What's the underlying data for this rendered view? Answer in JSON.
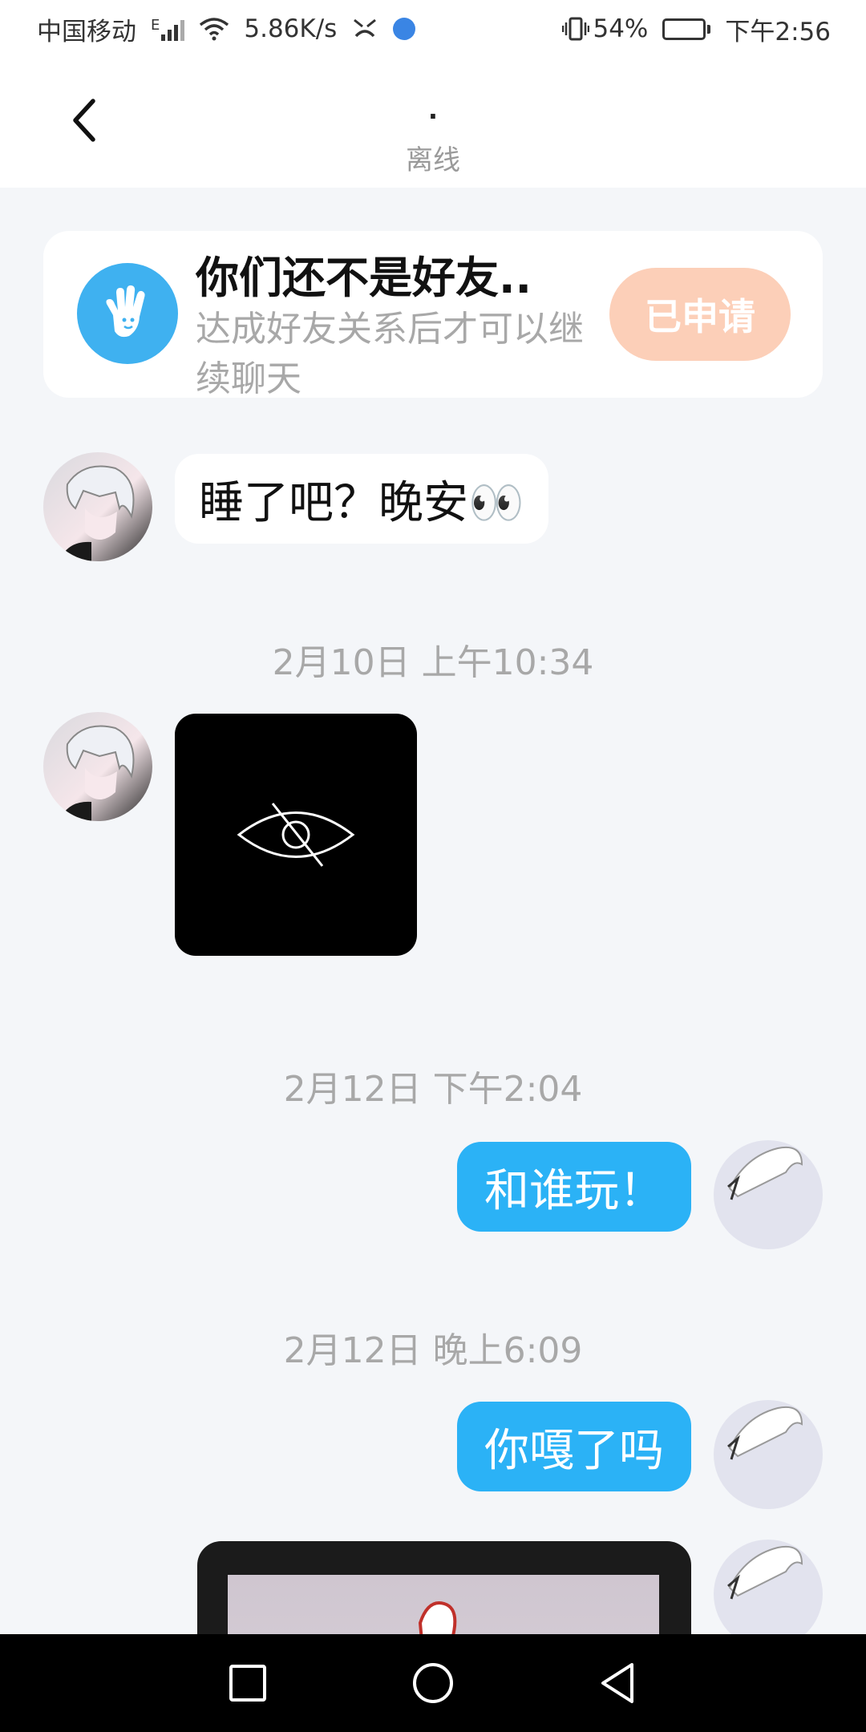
{
  "status_bar": {
    "carrier": "中国移动",
    "network_type": "E",
    "net_speed": "5.86K/s",
    "battery_percent": "54%",
    "battery_level": 0.54,
    "time": "下午2:56",
    "icons": [
      "signal-icon",
      "wifi-icon",
      "notification-icon",
      "browser-icon",
      "vibrate-icon",
      "battery-icon"
    ]
  },
  "header": {
    "title": ".",
    "status": "离线",
    "back_icon": "chevron-left-icon"
  },
  "notice": {
    "title": "你们还不是好友..",
    "description": "达成好友关系后才可以继续聊天",
    "button_label": "已申请",
    "icon": "wave-hand-icon",
    "icon_color": "#3fb1f0",
    "button_color": "#fccfb8"
  },
  "messages": [
    {
      "type": "text",
      "from": "other",
      "text": "睡了吧？晚安👀"
    },
    {
      "type": "timestamp",
      "text": "2月10日 上午10:34"
    },
    {
      "type": "image-hidden",
      "from": "other",
      "icon": "eye-slash-icon"
    },
    {
      "type": "timestamp",
      "text": "2月12日 下午2:04"
    },
    {
      "type": "text",
      "from": "self",
      "text": "和谁玩！"
    },
    {
      "type": "timestamp",
      "text": "2月12日 晚上6:09"
    },
    {
      "type": "text",
      "from": "self",
      "text": "你嘎了吗"
    },
    {
      "type": "video",
      "from": "self"
    }
  ],
  "colors": {
    "background": "#f4f6f9",
    "outgoing_bubble": "#2bb2f6",
    "incoming_bubble": "#ffffff",
    "timestamp_text": "#a8a8a8"
  },
  "nav_bar": {
    "icons": [
      "recent-apps-icon",
      "home-icon",
      "back-icon"
    ]
  }
}
